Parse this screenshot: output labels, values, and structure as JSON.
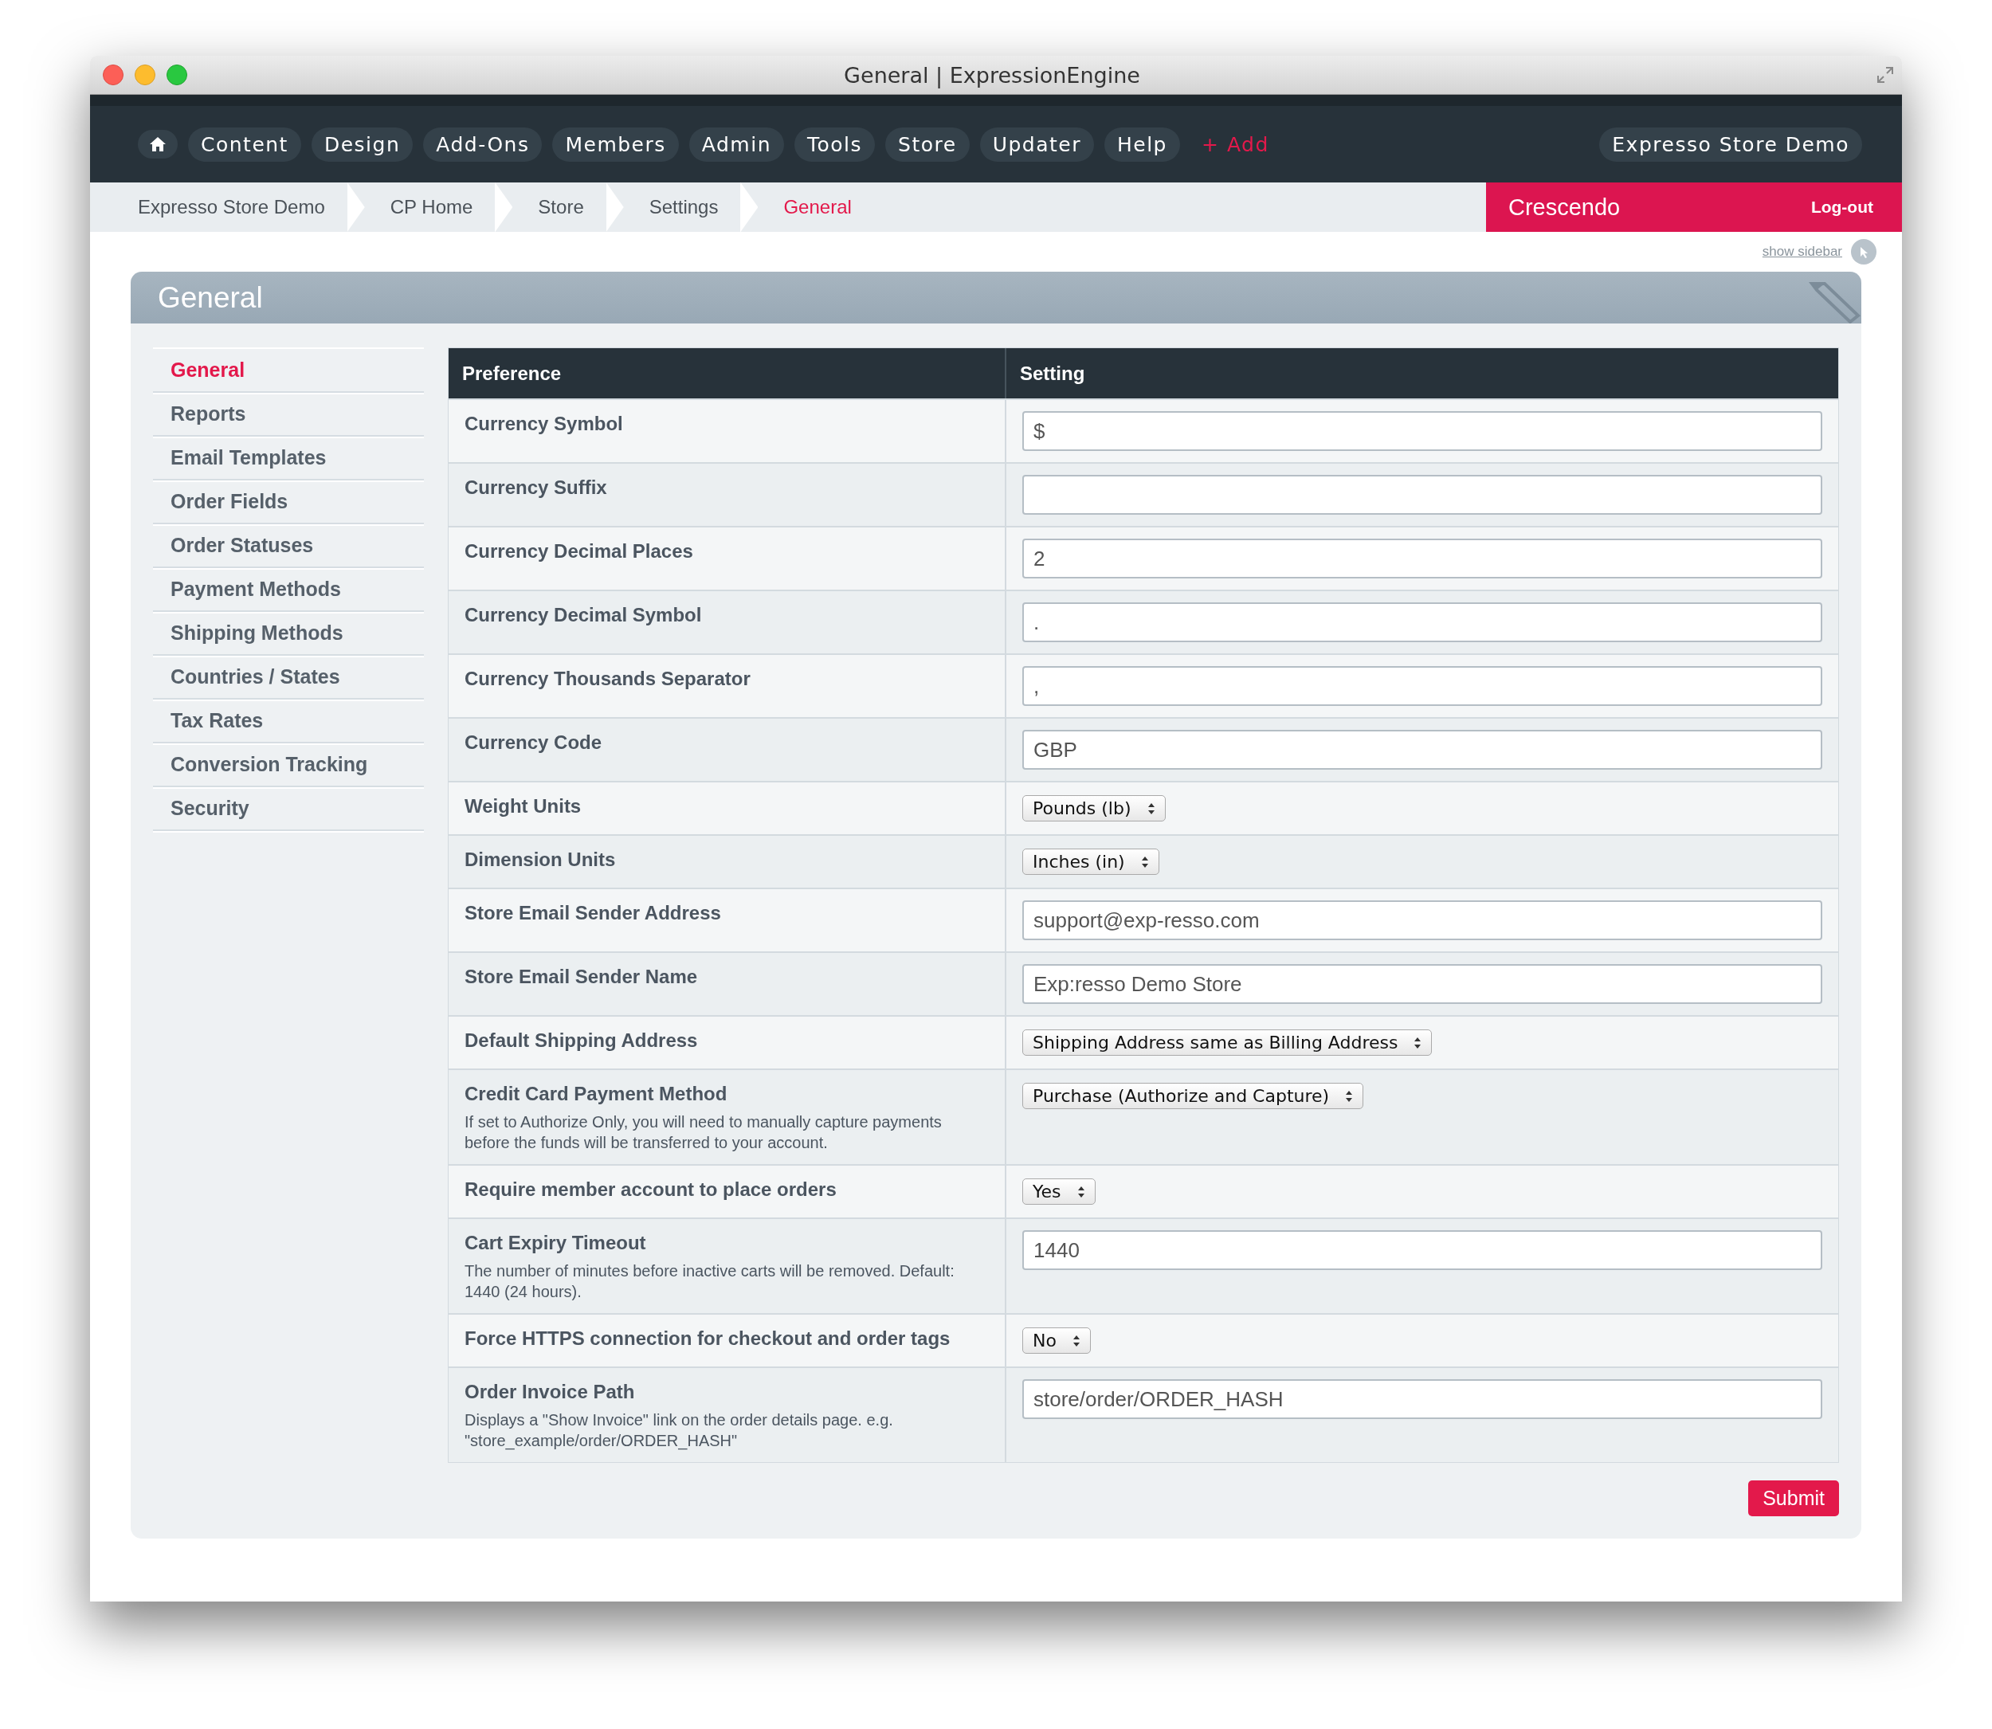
{
  "window": {
    "title": "General | ExpressionEngine"
  },
  "nav": {
    "items": [
      {
        "label": "Content"
      },
      {
        "label": "Design"
      },
      {
        "label": "Add-Ons"
      },
      {
        "label": "Members"
      },
      {
        "label": "Admin"
      },
      {
        "label": "Tools"
      },
      {
        "label": "Store"
      },
      {
        "label": "Updater"
      },
      {
        "label": "Help"
      }
    ],
    "add": "+ Add",
    "site": "Expresso Store Demo"
  },
  "breadcrumbs": [
    {
      "label": "Expresso Store Demo",
      "selected": false
    },
    {
      "label": "CP Home",
      "selected": false
    },
    {
      "label": "Store",
      "selected": false
    },
    {
      "label": "Settings",
      "selected": false
    },
    {
      "label": "General",
      "selected": true
    }
  ],
  "user": {
    "name": "Crescendo",
    "logout": "Log-out"
  },
  "show_sidebar": "show sidebar",
  "panel": {
    "title": "General"
  },
  "sidebar": {
    "items": [
      {
        "label": "General",
        "selected": true
      },
      {
        "label": "Reports",
        "selected": false
      },
      {
        "label": "Email Templates",
        "selected": false
      },
      {
        "label": "Order Fields",
        "selected": false
      },
      {
        "label": "Order Statuses",
        "selected": false
      },
      {
        "label": "Payment Methods",
        "selected": false
      },
      {
        "label": "Shipping Methods",
        "selected": false
      },
      {
        "label": "Countries / States",
        "selected": false
      },
      {
        "label": "Tax Rates",
        "selected": false
      },
      {
        "label": "Conversion Tracking",
        "selected": false
      },
      {
        "label": "Security",
        "selected": false
      }
    ]
  },
  "table": {
    "columns": [
      "Preference",
      "Setting"
    ],
    "rows": [
      {
        "label": "Currency Symbol",
        "kind": "text",
        "value": "$"
      },
      {
        "label": "Currency Suffix",
        "kind": "text"
      },
      {
        "label": "Currency Decimal Places",
        "kind": "text",
        "value": "2"
      },
      {
        "label": "Currency Decimal Symbol",
        "kind": "text",
        "value": "."
      },
      {
        "label": "Currency Thousands Separator",
        "kind": "text",
        "value": ","
      },
      {
        "label": "Currency Code",
        "kind": "text",
        "value": "GBP"
      },
      {
        "label": "Weight Units",
        "kind": "select",
        "value": "Pounds (lb)"
      },
      {
        "label": "Dimension Units",
        "kind": "select",
        "value": "Inches (in)"
      },
      {
        "label": "Store Email Sender Address",
        "kind": "text",
        "value": "support@exp-resso.com"
      },
      {
        "label": "Store Email Sender Name",
        "kind": "text",
        "value": "Exp:resso Demo Store"
      },
      {
        "label": "Default Shipping Address",
        "kind": "select",
        "value": "Shipping Address same as Billing Address"
      },
      {
        "label": "Credit Card Payment Method",
        "description": "If set to Authorize Only, you will need to manually capture payments before the funds will be transferred to your account.",
        "kind": "select",
        "value": "Purchase (Authorize and Capture)"
      },
      {
        "label": "Require member account to place orders",
        "kind": "select",
        "value": "Yes"
      },
      {
        "label": "Cart Expiry Timeout",
        "description": "The number of minutes before inactive carts will be removed. Default: 1440 (24 hours).",
        "kind": "text",
        "value": "1440"
      },
      {
        "label": "Force HTTPS connection for checkout and order tags",
        "kind": "select",
        "value": "No"
      },
      {
        "label": "Order Invoice Path",
        "description": "Displays a \"Show Invoice\" link on the order details page. e.g. \"store_example/order/ORDER_HASH\"",
        "kind": "text",
        "value": "store/order/ORDER_HASH"
      }
    ]
  },
  "submit": "Submit"
}
